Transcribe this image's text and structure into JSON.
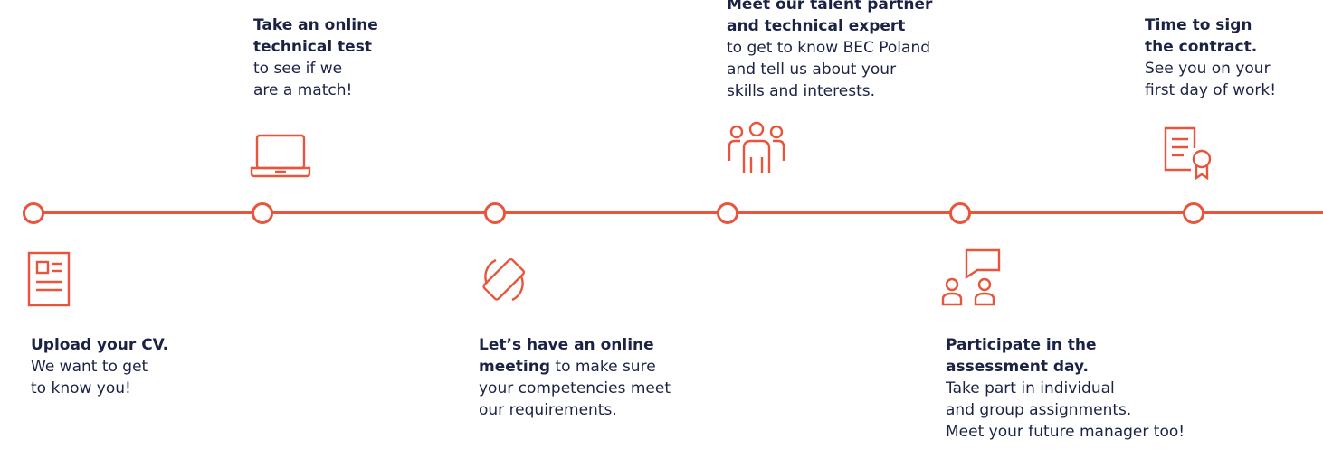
{
  "colors": {
    "accent": "#e8553c",
    "text": "#1b2345",
    "background": "#ffffff"
  },
  "steps": [
    {
      "icon": "cv-document-icon",
      "title": "Upload your CV.",
      "line1": "We want to get",
      "line2": "to know you!"
    },
    {
      "icon": "laptop-icon",
      "title1": "Take an online",
      "title2": "technical test",
      "line1": "to see if we",
      "line2": "are a match!"
    },
    {
      "icon": "rotate-phone-icon",
      "title": "Let’s have an online",
      "title_bold2": "meeting",
      "line1_rest": " to make sure",
      "line2": "your competencies meet",
      "line3": "our requirements."
    },
    {
      "icon": "team-icon",
      "title1": "Meet our talent partner",
      "title2": "and technical expert",
      "line1": "to get to know BEC Poland",
      "line2": "and tell us about your",
      "line3": "skills and interests."
    },
    {
      "icon": "assessment-chat-icon",
      "title1": "Participate in the",
      "title2": "assessment day.",
      "line1": "Take part in individual",
      "line2": "and group assignments.",
      "line3": "Meet your future manager too!"
    },
    {
      "icon": "contract-certificate-icon",
      "title1": "Time to sign",
      "title2": "the contract.",
      "line1": "See you on your",
      "line2": "first day of work!"
    }
  ]
}
